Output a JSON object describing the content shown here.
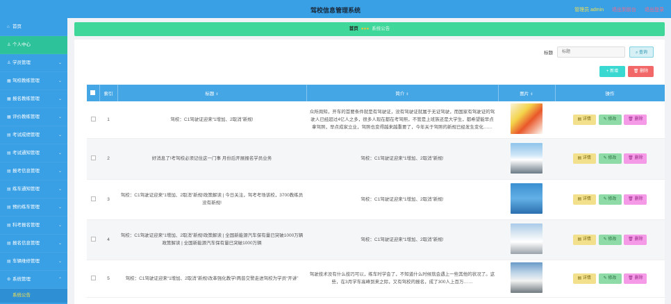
{
  "header": {
    "title": "驾校信息管理系统",
    "admin_label": "管理员 admin",
    "link_front": "退出到前台",
    "link_logout": "退出登录"
  },
  "sidebar": {
    "items": [
      {
        "label": "首页",
        "active": false
      },
      {
        "label": "个人中心",
        "active": true
      },
      {
        "label": "学员管理",
        "active": false
      },
      {
        "label": "驾校教练管理",
        "active": false
      },
      {
        "label": "报名教练管理",
        "active": false
      },
      {
        "label": "评价教练管理",
        "active": false
      },
      {
        "label": "考试成绩管理",
        "active": false
      },
      {
        "label": "考试通知管理",
        "active": false
      },
      {
        "label": "报考信息管理",
        "active": false
      },
      {
        "label": "练车通知管理",
        "active": false
      },
      {
        "label": "预约练车管理",
        "active": false
      },
      {
        "label": "科考报名管理",
        "active": false
      },
      {
        "label": "报名信息管理",
        "active": false
      },
      {
        "label": "车辆维修管理",
        "active": false
      },
      {
        "label": "系统管理",
        "active": false
      }
    ],
    "sub_item": "系统公告"
  },
  "breadcrumb": {
    "home": "首页",
    "separator": "●●●",
    "current": "系统公告"
  },
  "search": {
    "label": "标题",
    "placeholder": "标题",
    "button": "查询"
  },
  "actions": {
    "add": "+ 新增",
    "delete": "删除"
  },
  "table": {
    "headers": {
      "index": "索引",
      "title": "标题",
      "intro": "简介",
      "image": "图片",
      "operation": "操作"
    },
    "rows": [
      {
        "index": "1",
        "title": "驾校：C1驾驶证迎来“1增加、2取消”新规!",
        "intro": "众所周知，开车的首要条件就是有驾驶证，没有驾驶证就属于无证驾驶，而国家有驾驶证的驾驶人已经超过4亿人之多，很多人现在都在考驾照，不管是上班族还是大学生，都希望能早点拿驾照，早点成家立业，驾照也变得越来越重要了，今年关于驾照的新规已经发生变化……",
        "image_theme": "orange-car"
      },
      {
        "index": "2",
        "title": "好消息了!考驾校必须记住这一门事 月份后开展报名学员业务",
        "intro": "驾校：C1驾驶证迎来“1增加、2取消”新规!",
        "image_theme": "white-cars"
      },
      {
        "index": "3",
        "title": "驾校：C1驾驶证迎来“1增加、2取消”新规!政策解读 | 今日关注，驾考考场该校，3700教练员 没有新规!",
        "intro": "驾校：C1驾驶证迎来“1增加、2取消”新规!",
        "image_theme": "blue-sign"
      },
      {
        "index": "4",
        "title": "驾校：C1驾驶证迎来“1增加、2取消”新规!政策解读 | 全国新能源汽车保有量已突破1000万辆 政策解读 | 全国新能源汽车保有量已突破1000万辆",
        "intro": "驾校：C1驾驶证迎来“1增加、2取消”新规!",
        "image_theme": "parking-lot"
      },
      {
        "index": "5",
        "title": "驾校：C1驾驶证迎来“1增加、2取消”新规!改革强化教学!两普交警走进驾校为学员“开讲”",
        "intro": "驾驶技术没有什么技巧可以，练车时学会了，不知道什么时候就会遇上一些其他的状况了。这些，在3月学车高峰到来之际，又有驾校的报名，成了300人上百万……",
        "image_theme": "training-car"
      }
    ],
    "row_buttons": {
      "detail": "详情",
      "edit": "修改",
      "delete": "删除"
    }
  },
  "colors": {
    "topbar": "#3aa0e6",
    "sidebar_active": "#2ec29a",
    "breadcrumb": "#3fd79a",
    "table_header": "#45a6e6"
  }
}
